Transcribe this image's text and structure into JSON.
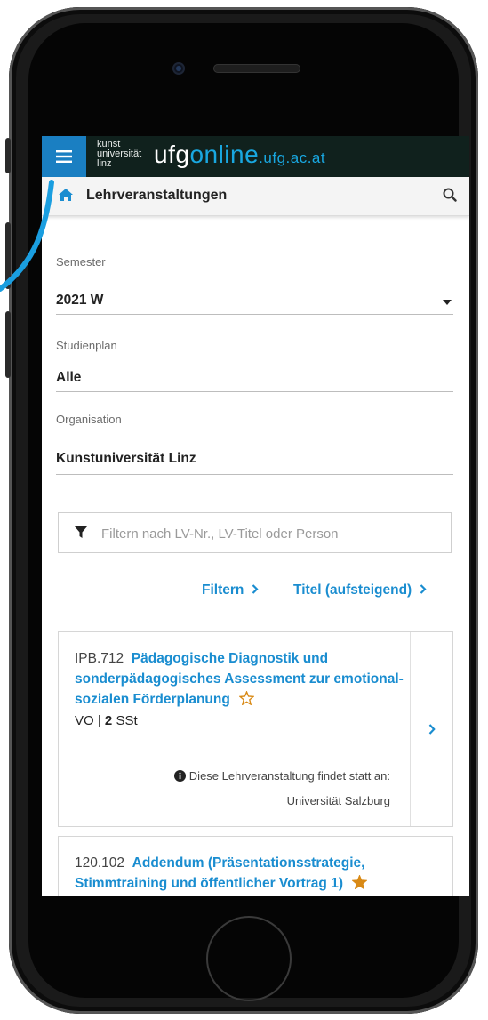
{
  "app": {
    "logo_small": [
      "kunst",
      "universität",
      "linz"
    ],
    "logo_main": "ufg",
    "logo_online": "online",
    "logo_domain": ".ufg.ac.at",
    "brand_color": "#19a7e0",
    "topbar_color": "#10211d",
    "menu_color": "#1a7fc2"
  },
  "header": {
    "title": "Lehrveranstaltungen",
    "home_icon": "home-icon",
    "search_icon": "search-icon"
  },
  "filters": {
    "semester": {
      "label": "Semester",
      "value": "2021 W"
    },
    "studienplan": {
      "label": "Studienplan",
      "value": "Alle"
    },
    "organisation": {
      "label": "Organisation",
      "value": "Kunstuniversität Linz"
    },
    "search": {
      "placeholder": "Filtern nach LV-Nr., LV-Titel oder Person"
    },
    "filter_link": "Filtern",
    "sort_link": "Titel (aufsteigend)"
  },
  "courses": [
    {
      "number": "IPB.712",
      "title": "Pädagogische Diagnostik und sonderpädagogisches Assessment zur emotional-sozialen Förderplanung",
      "type": "VO",
      "hours": "2",
      "hours_unit": "SSt",
      "favorite": false,
      "info_label": "Diese Lehrveranstaltung findet statt an:",
      "info_place": "Universität Salzburg"
    },
    {
      "number": "120.102",
      "title": "Addendum (Präsentationsstrategie, Stimmtraining und öffentlicher Vortrag 1)",
      "favorite": true
    }
  ]
}
